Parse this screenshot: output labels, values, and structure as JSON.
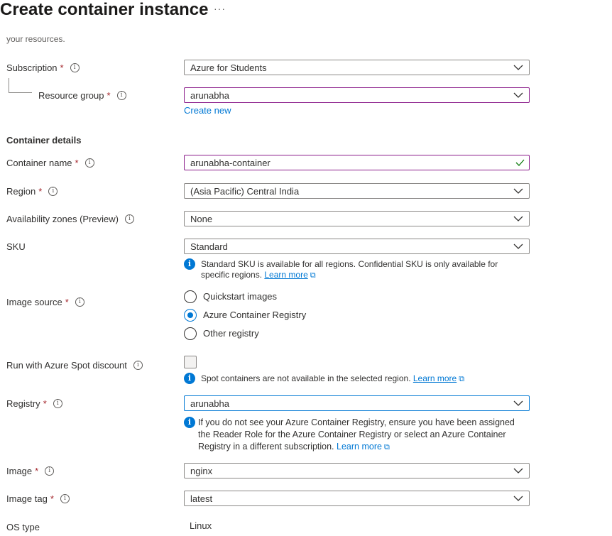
{
  "header": {
    "title": "Create container instance",
    "more": "···"
  },
  "scrolled_text": "your resources.",
  "required_marker": "*",
  "info_glyph": "i",
  "subscription": {
    "label": "Subscription",
    "value": "Azure for Students"
  },
  "resource_group": {
    "label": "Resource group",
    "value": "arunabha",
    "create_new": "Create new"
  },
  "section_title": "Container details",
  "container_name": {
    "label": "Container name",
    "value": "arunabha-container"
  },
  "region": {
    "label": "Region",
    "value": "(Asia Pacific) Central India"
  },
  "availability_zones": {
    "label": "Availability zones (Preview)",
    "value": "None"
  },
  "sku": {
    "label": "SKU",
    "value": "Standard",
    "info_line1": "Standard SKU is available for all regions. Confidential SKU is only available for",
    "info_line2": "specific regions. ",
    "learn_more": "Learn more"
  },
  "image_source": {
    "label": "Image source",
    "options": [
      "Quickstart images",
      "Azure Container Registry",
      "Other registry"
    ],
    "selected": "Azure Container Registry"
  },
  "spot": {
    "label": "Run with Azure Spot discount",
    "checked": false,
    "info": "Spot containers are not available in the selected region. ",
    "learn_more": "Learn more"
  },
  "registry": {
    "label": "Registry",
    "value": "arunabha",
    "info_line1": "If you do not see your Azure Container Registry, ensure you have been assigned",
    "info_line2": "the Reader Role for the Azure Container Registry or select an Azure Container",
    "info_line3": "Registry in a different subscription. ",
    "learn_more": "Learn more"
  },
  "image": {
    "label": "Image",
    "value": "nginx"
  },
  "image_tag": {
    "label": "Image tag",
    "value": "latest"
  },
  "os_type": {
    "label": "OS type",
    "value": "Linux"
  },
  "colors": {
    "accent": "#0078d4",
    "required": "#a4262c",
    "active_border": "#8a1c8a",
    "success": "#107c10"
  }
}
